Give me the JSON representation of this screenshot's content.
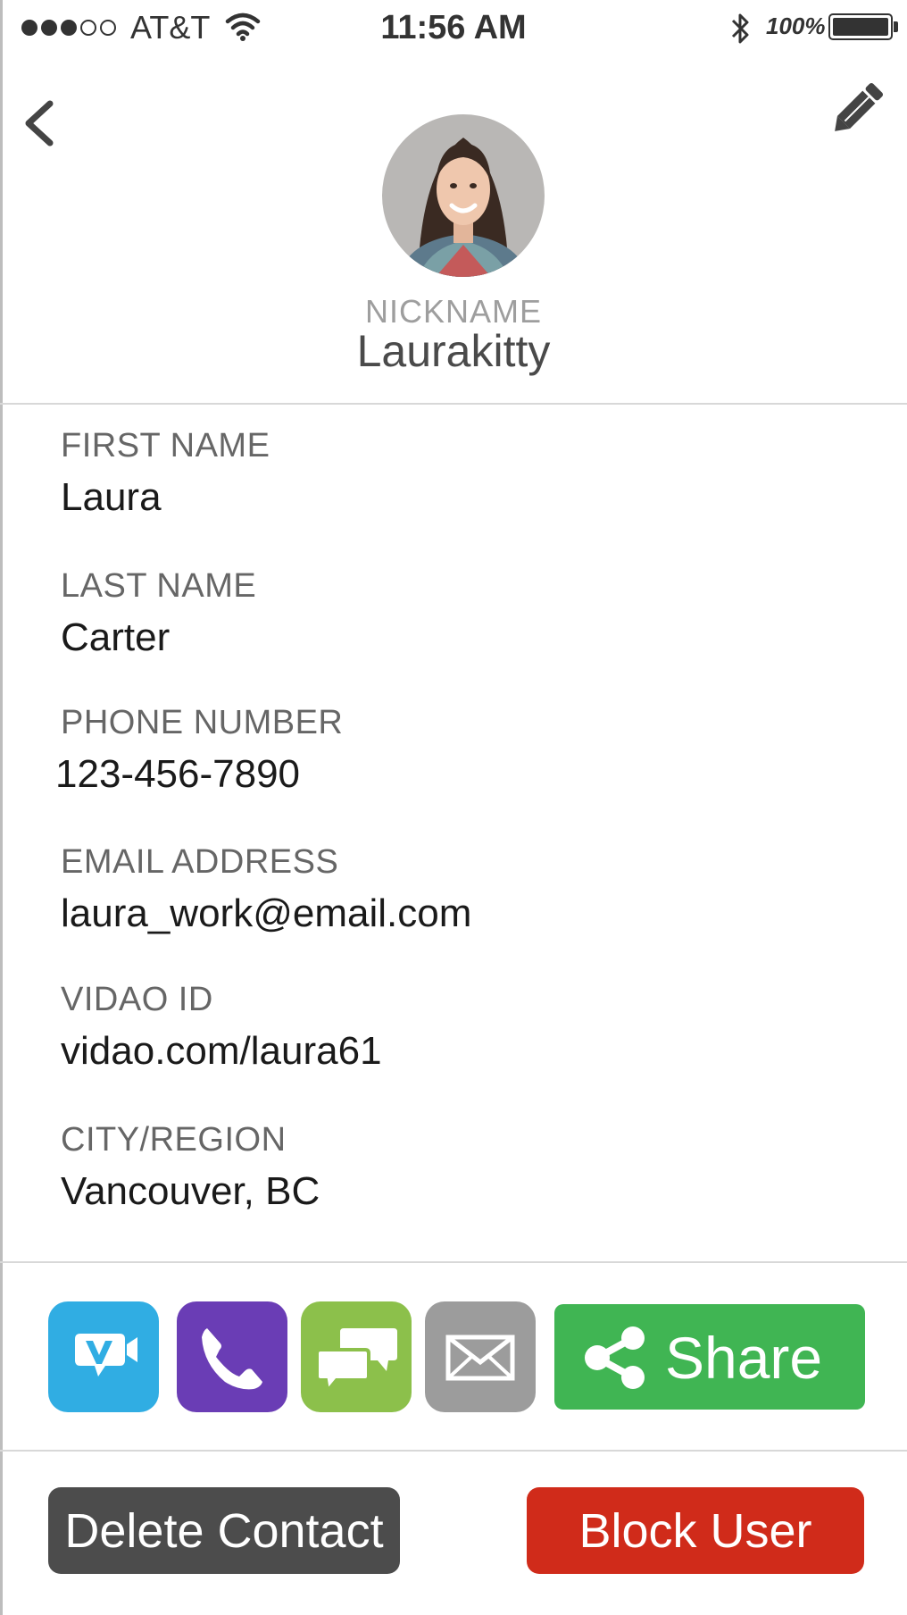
{
  "status_bar": {
    "carrier": "AT&T",
    "time": "11:56 AM",
    "battery": "100%",
    "signal_icon": "signal-dots-icon",
    "wifi_icon": "wifi-icon",
    "bluetooth_icon": "bluetooth-icon",
    "battery_icon": "battery-icon"
  },
  "header": {
    "back_icon": "chevron-left-icon",
    "edit_icon": "pencil-icon",
    "nickname_label": "NICKNAME",
    "nickname": "Laurakitty"
  },
  "fields": [
    {
      "label": "FIRST NAME",
      "value": "Laura"
    },
    {
      "label": "LAST NAME",
      "value": "Carter"
    },
    {
      "label": "PHONE NUMBER",
      "value": "123-456-7890"
    },
    {
      "label": "EMAIL ADDRESS",
      "value": "laura_work@email.com"
    },
    {
      "label": "VIDAO ID",
      "value": "vidao.com/laura61"
    },
    {
      "label": "CITY/REGION",
      "value": "Vancouver, BC"
    }
  ],
  "actions": {
    "video_call_icon": "video-camera-icon",
    "phone_icon": "phone-icon",
    "chat_icon": "chat-bubbles-icon",
    "email_icon": "envelope-icon",
    "share_icon": "share-icon",
    "share_label": "Share",
    "colors": {
      "video": "#30ade3",
      "phone": "#6a3db5",
      "chat": "#8cc04b",
      "email": "#9c9c9c",
      "share": "#40b553"
    }
  },
  "buttons": {
    "delete_label": "Delete Contact",
    "block_label": "Block User",
    "delete_color": "#4c4c4c",
    "block_color": "#d02b1a"
  }
}
